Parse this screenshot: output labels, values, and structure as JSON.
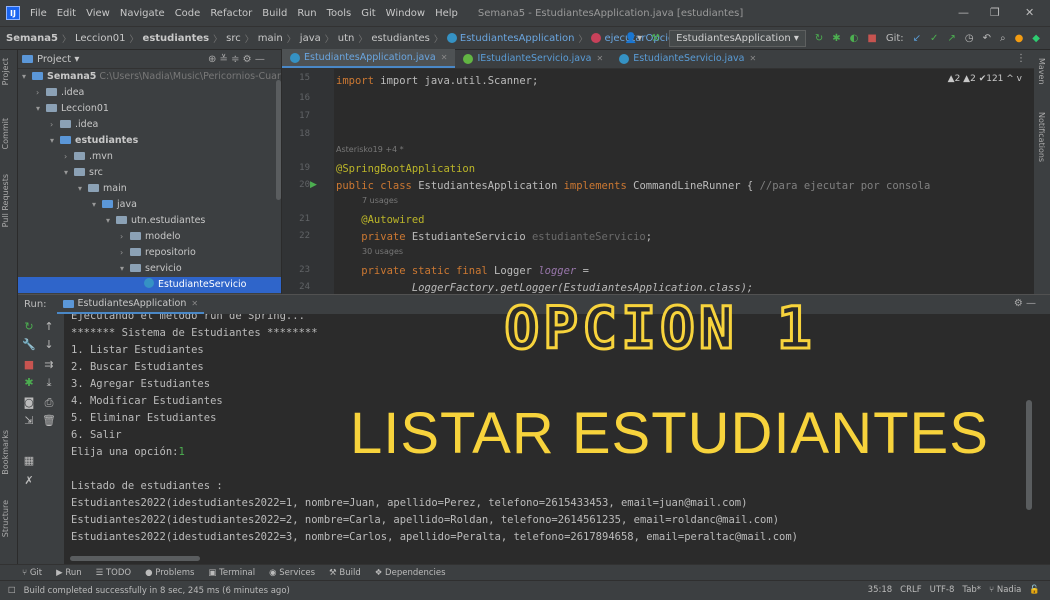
{
  "menubar": {
    "logo": "IJ",
    "items": [
      "File",
      "Edit",
      "View",
      "Navigate",
      "Code",
      "Refactor",
      "Build",
      "Run",
      "Tools",
      "Git",
      "Window",
      "Help"
    ],
    "title": "Semana5 - EstudiantesApplication.java [estudiantes]",
    "controls": {
      "minimize": "—",
      "maximize": "❐",
      "close": "✕"
    }
  },
  "breadcrumb": [
    "Semana5",
    "Leccion01",
    "estudiantes",
    "src",
    "main",
    "java",
    "utn",
    "estudiantes",
    "EstudiantesApplication",
    "ejecutarOpciones"
  ],
  "toolbar": {
    "run_config": "EstudiantesApplication ▾",
    "git_label": "Git:"
  },
  "side_tabs_left": [
    "Project",
    "Commit",
    "Pull Requests",
    "Bookmarks",
    "Structure"
  ],
  "side_tabs_right": [
    "Maven",
    "Notifications"
  ],
  "project": {
    "header": "Project ▾",
    "tree": [
      {
        "label": "Semana5",
        "path": "C:\\Users\\Nadia\\Music\\Pericornios-Cuarto-Se"
      },
      {
        "label": ".idea"
      },
      {
        "label": "Leccion01"
      },
      {
        "label": ".idea"
      },
      {
        "label": "estudiantes"
      },
      {
        "label": ".mvn"
      },
      {
        "label": "src"
      },
      {
        "label": "main"
      },
      {
        "label": "java"
      },
      {
        "label": "utn.estudiantes"
      },
      {
        "label": "modelo"
      },
      {
        "label": "repositorio"
      },
      {
        "label": "servicio"
      },
      {
        "label": "EstudianteServicio"
      }
    ]
  },
  "editor": {
    "tabs": [
      "EstudiantesApplication.java",
      "IEstudianteServicio.java",
      "EstudianteServicio.java"
    ],
    "inspections": "▲2  ▲2  ✔121  ^  v",
    "lines": [
      {
        "n": "15",
        "text": "import java.util.Scanner;"
      },
      {
        "n": "16",
        "text": ""
      },
      {
        "n": "17",
        "text": ""
      },
      {
        "n": "18",
        "text": ""
      },
      {
        "hint": "Asterisko19 +4 *"
      },
      {
        "n": "19",
        "text": "@SpringBootApplication"
      },
      {
        "n": "20",
        "kw": "public class ",
        "text": "EstudiantesApplication ",
        "kw2": "implements ",
        "text2": "CommandLineRunner { ",
        "cmt": "//para ejecutar por consola"
      },
      {
        "hint": "7 usages"
      },
      {
        "n": "21",
        "text": "    @Autowired"
      },
      {
        "n": "22",
        "kw": "    private ",
        "text": "EstudianteServicio ",
        "fld": "estudianteServicio",
        "text2": ";"
      },
      {
        "hint": "30 usages"
      },
      {
        "n": "23",
        "kw": "    private static final ",
        "text": "Logger ",
        "fld": "logger",
        "text2": " ="
      },
      {
        "n": "24",
        "text": "            LoggerFactory.getLogger(EstudiantesApplication.class);"
      }
    ]
  },
  "run": {
    "label": "Run:",
    "tab": "EstudiantesApplication",
    "console": [
      "Ejecutando el metodo run de Spring...",
      "******* Sistema de Estudiantes ********",
      "1. Listar Estudiantes",
      "2. Buscar Estudiantes",
      "3. Agregar Estudiantes",
      "4. Modificar Estudiantes",
      "5. Eliminar Estudiantes",
      "6. Salir",
      "Elija una opción:",
      "",
      "Listado de estudiantes :",
      "Estudiantes2022(idestudiantes2022=1, nombre=Juan, apellido=Perez, telefono=2615433453, email=juan@mail.com)",
      "Estudiantes2022(idestudiantes2022=2, nombre=Carla, apellido=Roldan, telefono=2614561235, email=roldanc@mail.com)",
      "Estudiantes2022(idestudiantes2022=3, nombre=Carlos, apellido=Peralta, telefono=2617894658, email=peraltac@mail.com)"
    ],
    "input_value": "1"
  },
  "overlay": {
    "title": "OPCION 1",
    "subtitle": "LISTAR ESTUDIANTES",
    "color": "#f7d33c"
  },
  "bottom_tabs": [
    "Git",
    "Run",
    "TODO",
    "Problems",
    "Terminal",
    "Services",
    "Build",
    "Dependencies"
  ],
  "status": {
    "message": "Build completed successfully in 8 sec, 245 ms (6 minutes ago)",
    "position": "35:18",
    "line_sep": "CRLF",
    "encoding": "UTF-8",
    "indent": "Tab*",
    "user": "Nadia"
  }
}
